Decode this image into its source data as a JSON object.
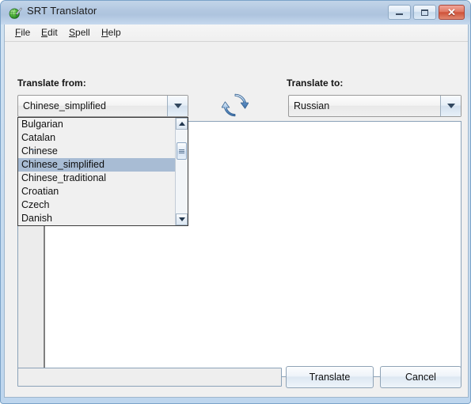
{
  "window": {
    "title": "SRT Translator",
    "icon": "globe-pen-icon",
    "controls": {
      "minimize_label": "Minimize",
      "maximize_label": "Maximize",
      "close_label": "Close",
      "close_glyph": "✕",
      "close_color": "#cf5239"
    }
  },
  "menubar": {
    "items": [
      {
        "label": "File",
        "mnemonic": "F",
        "rest": "ile"
      },
      {
        "label": "Edit",
        "mnemonic": "E",
        "rest": "dit"
      },
      {
        "label": "Spell",
        "mnemonic": "S",
        "rest": "pell"
      },
      {
        "label": "Help",
        "mnemonic": "H",
        "rest": "elp"
      }
    ]
  },
  "form": {
    "from": {
      "label": "Translate from:",
      "selected": "Chinese_simplified",
      "dropdown_open": true,
      "options": [
        "Bulgarian",
        "Catalan",
        "Chinese",
        "Chinese_simplified",
        "Chinese_traditional",
        "Croatian",
        "Czech",
        "Danish"
      ],
      "highlight_color": "#a8bcd4"
    },
    "to": {
      "label": "Translate to:",
      "selected": "Russian",
      "dropdown_open": false
    },
    "swap": {
      "icon": "swap-arrows-icon",
      "label": "Swap languages",
      "color": "#4a7ab5"
    }
  },
  "editor": {
    "content": "",
    "gutter_content": ""
  },
  "bottom": {
    "progress_value": "",
    "translate_label": "Translate",
    "cancel_label": "Cancel"
  }
}
